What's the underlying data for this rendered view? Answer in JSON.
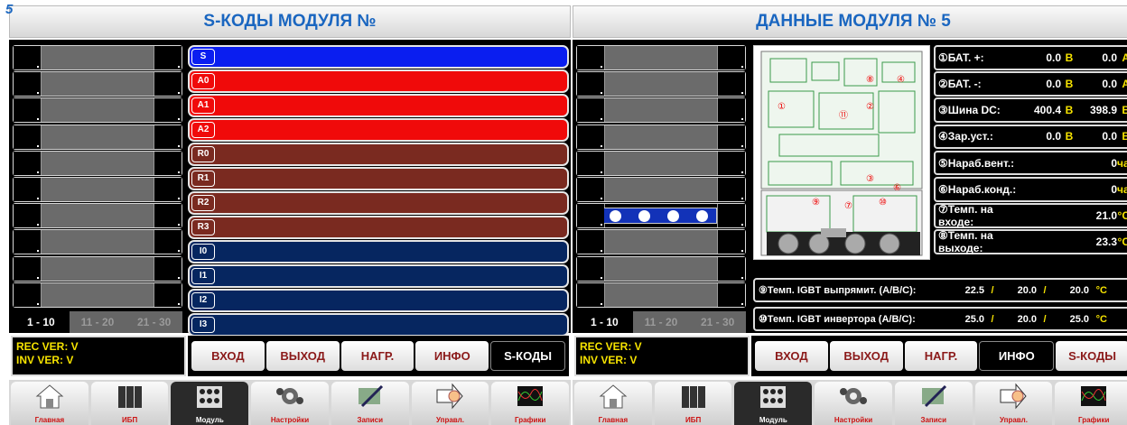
{
  "corner_number": "5",
  "left": {
    "title": "S-КОДЫ МОДУЛЯ №",
    "codes": [
      {
        "tag": "S",
        "color": "#0a1ef0"
      },
      {
        "tag": "A0",
        "color": "#f00a0a"
      },
      {
        "tag": "A1",
        "color": "#f00a0a"
      },
      {
        "tag": "A2",
        "color": "#f00a0a"
      },
      {
        "tag": "R0",
        "color": "#7a2a20"
      },
      {
        "tag": "R1",
        "color": "#7a2a20"
      },
      {
        "tag": "R2",
        "color": "#7a2a20"
      },
      {
        "tag": "R3",
        "color": "#7a2a20"
      },
      {
        "tag": "I0",
        "color": "#062660"
      },
      {
        "tag": "I1",
        "color": "#062660"
      },
      {
        "tag": "I2",
        "color": "#062660"
      },
      {
        "tag": "I3",
        "color": "#062660"
      }
    ],
    "pager": [
      "1 - 10",
      "11 - 20",
      "21 - 30"
    ],
    "ver_rec": "REC VER: V",
    "ver_inv": "INV VER: V",
    "tabs": [
      "ВХОД",
      "ВЫХОД",
      "НАГР.",
      "ИНФО",
      "S-КОДЫ"
    ],
    "active_tab": "S-КОДЫ"
  },
  "right": {
    "title": "ДАННЫЕ МОДУЛЯ № 5",
    "selected_module": "5",
    "pager": [
      "1 - 10",
      "11 - 20",
      "21 - 30"
    ],
    "data_rows": [
      {
        "label": "①БАТ. +:",
        "v1": "0.0",
        "u1": "В",
        "v2": "0.0",
        "u2": "А"
      },
      {
        "label": "②БАТ. -:",
        "v1": "0.0",
        "u1": "В",
        "v2": "0.0",
        "u2": "А"
      },
      {
        "label": "③Шина DC:",
        "v1": "400.4",
        "u1": "В",
        "v2": "398.9",
        "u2": "В"
      },
      {
        "label": "④Зар.уст.:",
        "v1": "0.0",
        "u1": "В",
        "v2": "0.0",
        "u2": "В"
      },
      {
        "label": "⑤Нараб.вент.:",
        "v1": "",
        "u1": "",
        "v2": "0",
        "u2": "час"
      },
      {
        "label": "⑥Нараб.конд.:",
        "v1": "",
        "u1": "",
        "v2": "0",
        "u2": "час"
      },
      {
        "label": "⑦Темп. на входе:",
        "v1": "",
        "u1": "",
        "v2": "21.0",
        "u2": "°C"
      },
      {
        "label": "⑧Темп. на выходе:",
        "v1": "",
        "u1": "",
        "v2": "23.3",
        "u2": "°C"
      }
    ],
    "igbt_rows": [
      {
        "label": "⑨Темп. IGBT выпрямит. (A/B/C):",
        "a": "22.5",
        "b": "20.0",
        "c": "20.0",
        "sep": "/",
        "unit": "°C"
      },
      {
        "label": "⑩Темп. IGBT инвертора (A/B/C):",
        "a": "25.0",
        "b": "20.0",
        "c": "25.0",
        "sep": "/",
        "unit": "°C"
      }
    ],
    "ver_rec": "REC VER: V",
    "ver_inv": "INV VER: V",
    "tabs": [
      "ВХОД",
      "ВЫХОД",
      "НАГР.",
      "ИНФО",
      "S-КОДЫ"
    ],
    "active_tab": "ИНФО"
  },
  "nav": [
    {
      "label": "Главная",
      "icon": "home-icon"
    },
    {
      "label": "ИБП",
      "icon": "ups-icon"
    },
    {
      "label": "Модуль",
      "icon": "module-icon"
    },
    {
      "label": "Настройки",
      "icon": "settings-icon"
    },
    {
      "label": "Записи",
      "icon": "records-icon"
    },
    {
      "label": "Управл.",
      "icon": "control-icon"
    },
    {
      "label": "Графики",
      "icon": "graphs-icon"
    }
  ],
  "nav_active": "Модуль",
  "colors": {
    "title": "#1a66c0",
    "accent_yellow": "#f6e300",
    "tab_text": "#8b1a1a"
  }
}
